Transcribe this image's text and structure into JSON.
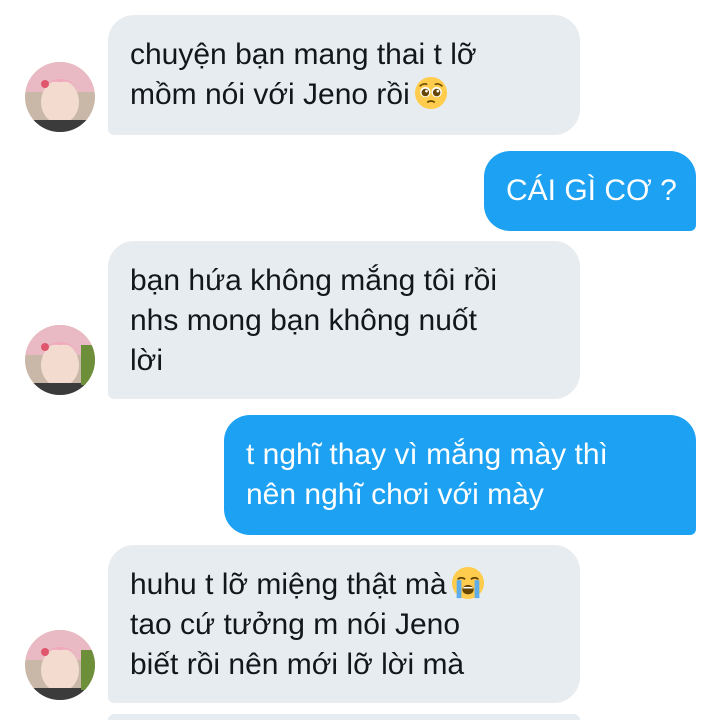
{
  "conversation": {
    "messages": [
      {
        "direction": "incoming",
        "lines": [
          "chuyện bạn mang thai t lỡ",
          "mồm nói với Jeno rồi"
        ],
        "emoji": "pleading-face-emoji"
      },
      {
        "direction": "outgoing",
        "lines": [
          "CÁI GÌ CƠ ?"
        ]
      },
      {
        "direction": "incoming",
        "lines": [
          "bạn hứa không mắng tôi rồi",
          "nhs mong bạn không nuốt",
          "lời"
        ]
      },
      {
        "direction": "outgoing",
        "lines": [
          "t nghĩ thay vì mắng mày thì",
          "nên nghĩ chơi với mày"
        ]
      },
      {
        "direction": "incoming",
        "lines": [
          "huhu t lỡ miệng thật mà",
          "tao cứ tưởng m nói Jeno",
          "biết rồi nên mới lỡ lời mà"
        ],
        "emoji": "loudly-crying-face-emoji"
      }
    ]
  },
  "colors": {
    "incoming_bubble": "#e6ecf0",
    "outgoing_bubble": "#1da1f2",
    "incoming_text": "#14171a",
    "outgoing_text": "#ffffff"
  }
}
